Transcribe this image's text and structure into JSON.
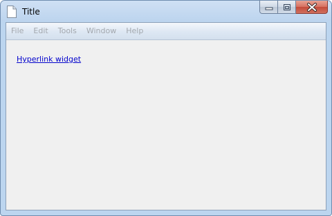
{
  "window": {
    "title": "Title",
    "icon": "document-icon"
  },
  "caption_buttons": {
    "minimize": "minimize-icon",
    "maximize": "maximize-icon",
    "close": "close-icon"
  },
  "menubar": {
    "items": [
      {
        "label": "File"
      },
      {
        "label": "Edit"
      },
      {
        "label": "Tools"
      },
      {
        "label": "Window"
      },
      {
        "label": "Help"
      }
    ]
  },
  "content": {
    "hyperlink_label": "Hyperlink widget"
  },
  "colors": {
    "titlebar": "#bcd4ee",
    "close_button": "#c44a39",
    "menu_text_disabled": "#a3a8ae",
    "link": "#0000cc",
    "content_bg": "#f0f0f0"
  }
}
